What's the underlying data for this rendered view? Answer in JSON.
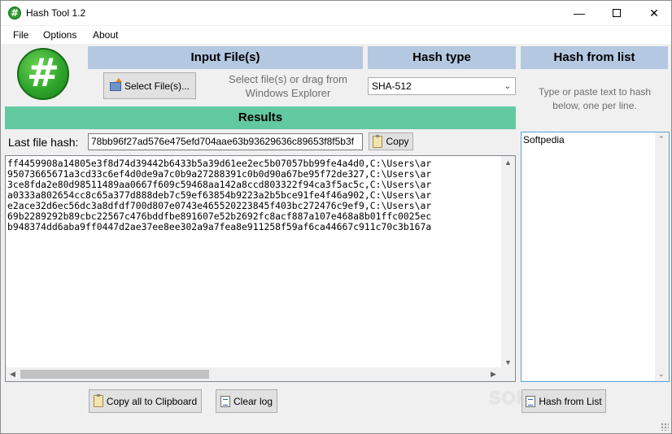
{
  "window": {
    "title": "Hash Tool 1.2"
  },
  "menu": {
    "file": "File",
    "options": "Options",
    "about": "About"
  },
  "headers": {
    "input_files": "Input File(s)",
    "hash_type": "Hash type",
    "hash_from_list": "Hash from list",
    "results": "Results"
  },
  "input": {
    "select_button": "Select File(s)...",
    "drop_hint_line1": "Select file(s) or drag from",
    "drop_hint_line2": "Windows Explorer"
  },
  "hash_type": {
    "selected": "SHA-512"
  },
  "list": {
    "hint_line1": "Type or paste text to hash",
    "hint_line2": "below, one per line.",
    "text": "Softpedia",
    "button": "Hash from List"
  },
  "last_hash": {
    "label": "Last file hash:",
    "value": "78bb96f27ad576e475efd704aae63b93629636c89653f8f5b3f",
    "copy_button": "Copy"
  },
  "results": {
    "text": "ff4459908a14805e3f8d74d39442b6433b5a39d61ee2ec5b07057bb99fe4a4d0,C:\\Users\\ar\n95073665671a3cd33c6ef4d0de9a7c0b9a27288391c0b0d90a67be95f72de327,C:\\Users\\ar\n3ce8fda2e80d98511489aa0667f609c59468aa142a8ccd803322f94ca3f5ac5c,C:\\Users\\ar\na0333a802654cc8c65a377d888deb7c59ef63854b9223a2b5bce91fe4f46a902,C:\\Users\\ar\ne2ace32d6ec56dc3a8dfdf700d807e0743e465520223845f403bc272476c9ef9,C:\\Users\\ar\n69b2289292b89cbc22567c476bddfbe891607e52b2692fc8acf887a107e468a8b01ffc0025ec\nb948374dd6aba9ff0447d2ae37ee8ee302a9a7fea8e911258f59af6ca44667c911c70c3b167a"
  },
  "bottom": {
    "copy_all": "Copy all to Clipboard",
    "clear_log": "Clear log"
  },
  "watermark": "SOFTPEDIA",
  "icons": {
    "app": "hash-icon",
    "logo": "hash-logo-icon",
    "select": "folder-arrow-icon",
    "copy": "clipboard-icon",
    "clear": "clear-log-icon",
    "list": "list-icon"
  },
  "colors": {
    "section_header": "#b4c8e1",
    "results_header": "#62c9a1",
    "logo_green": "#2fa52a"
  }
}
